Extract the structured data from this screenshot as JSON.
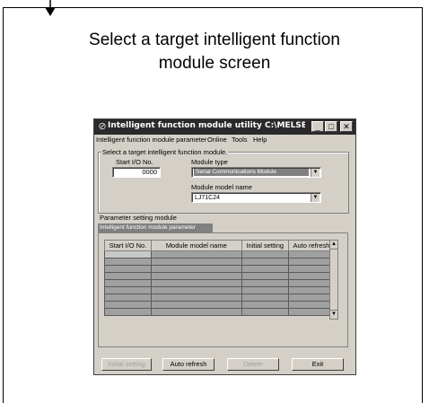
{
  "caption": {
    "line1": "Select a target intelligent function",
    "line2": "module screen"
  },
  "window": {
    "title": "Intelligent function module utility C:\\MELSEC\\GPPW\\asas",
    "menu": [
      "Intelligent function module parameter",
      "Online",
      "Tools",
      "Help"
    ],
    "group_title": "Select a target intelligent function module.",
    "start_io_label": "Start I/O No.",
    "start_io_value": "0000",
    "module_type_label": "Module type",
    "module_type_value": "Serial Communications Module",
    "module_model_label": "Module model name",
    "module_model_value": "LJ71C24",
    "param_setting_label": "Parameter setting module",
    "tab_label": "Intelligent function module parameter",
    "table": {
      "columns": [
        "Start I/O No.",
        "Module model name",
        "Initial setting",
        "Auto refresh"
      ]
    },
    "buttons": {
      "initial_setting": "Initial setting",
      "auto_refresh": "Auto refresh",
      "delete": "Delete",
      "exit": "Exit"
    }
  }
}
